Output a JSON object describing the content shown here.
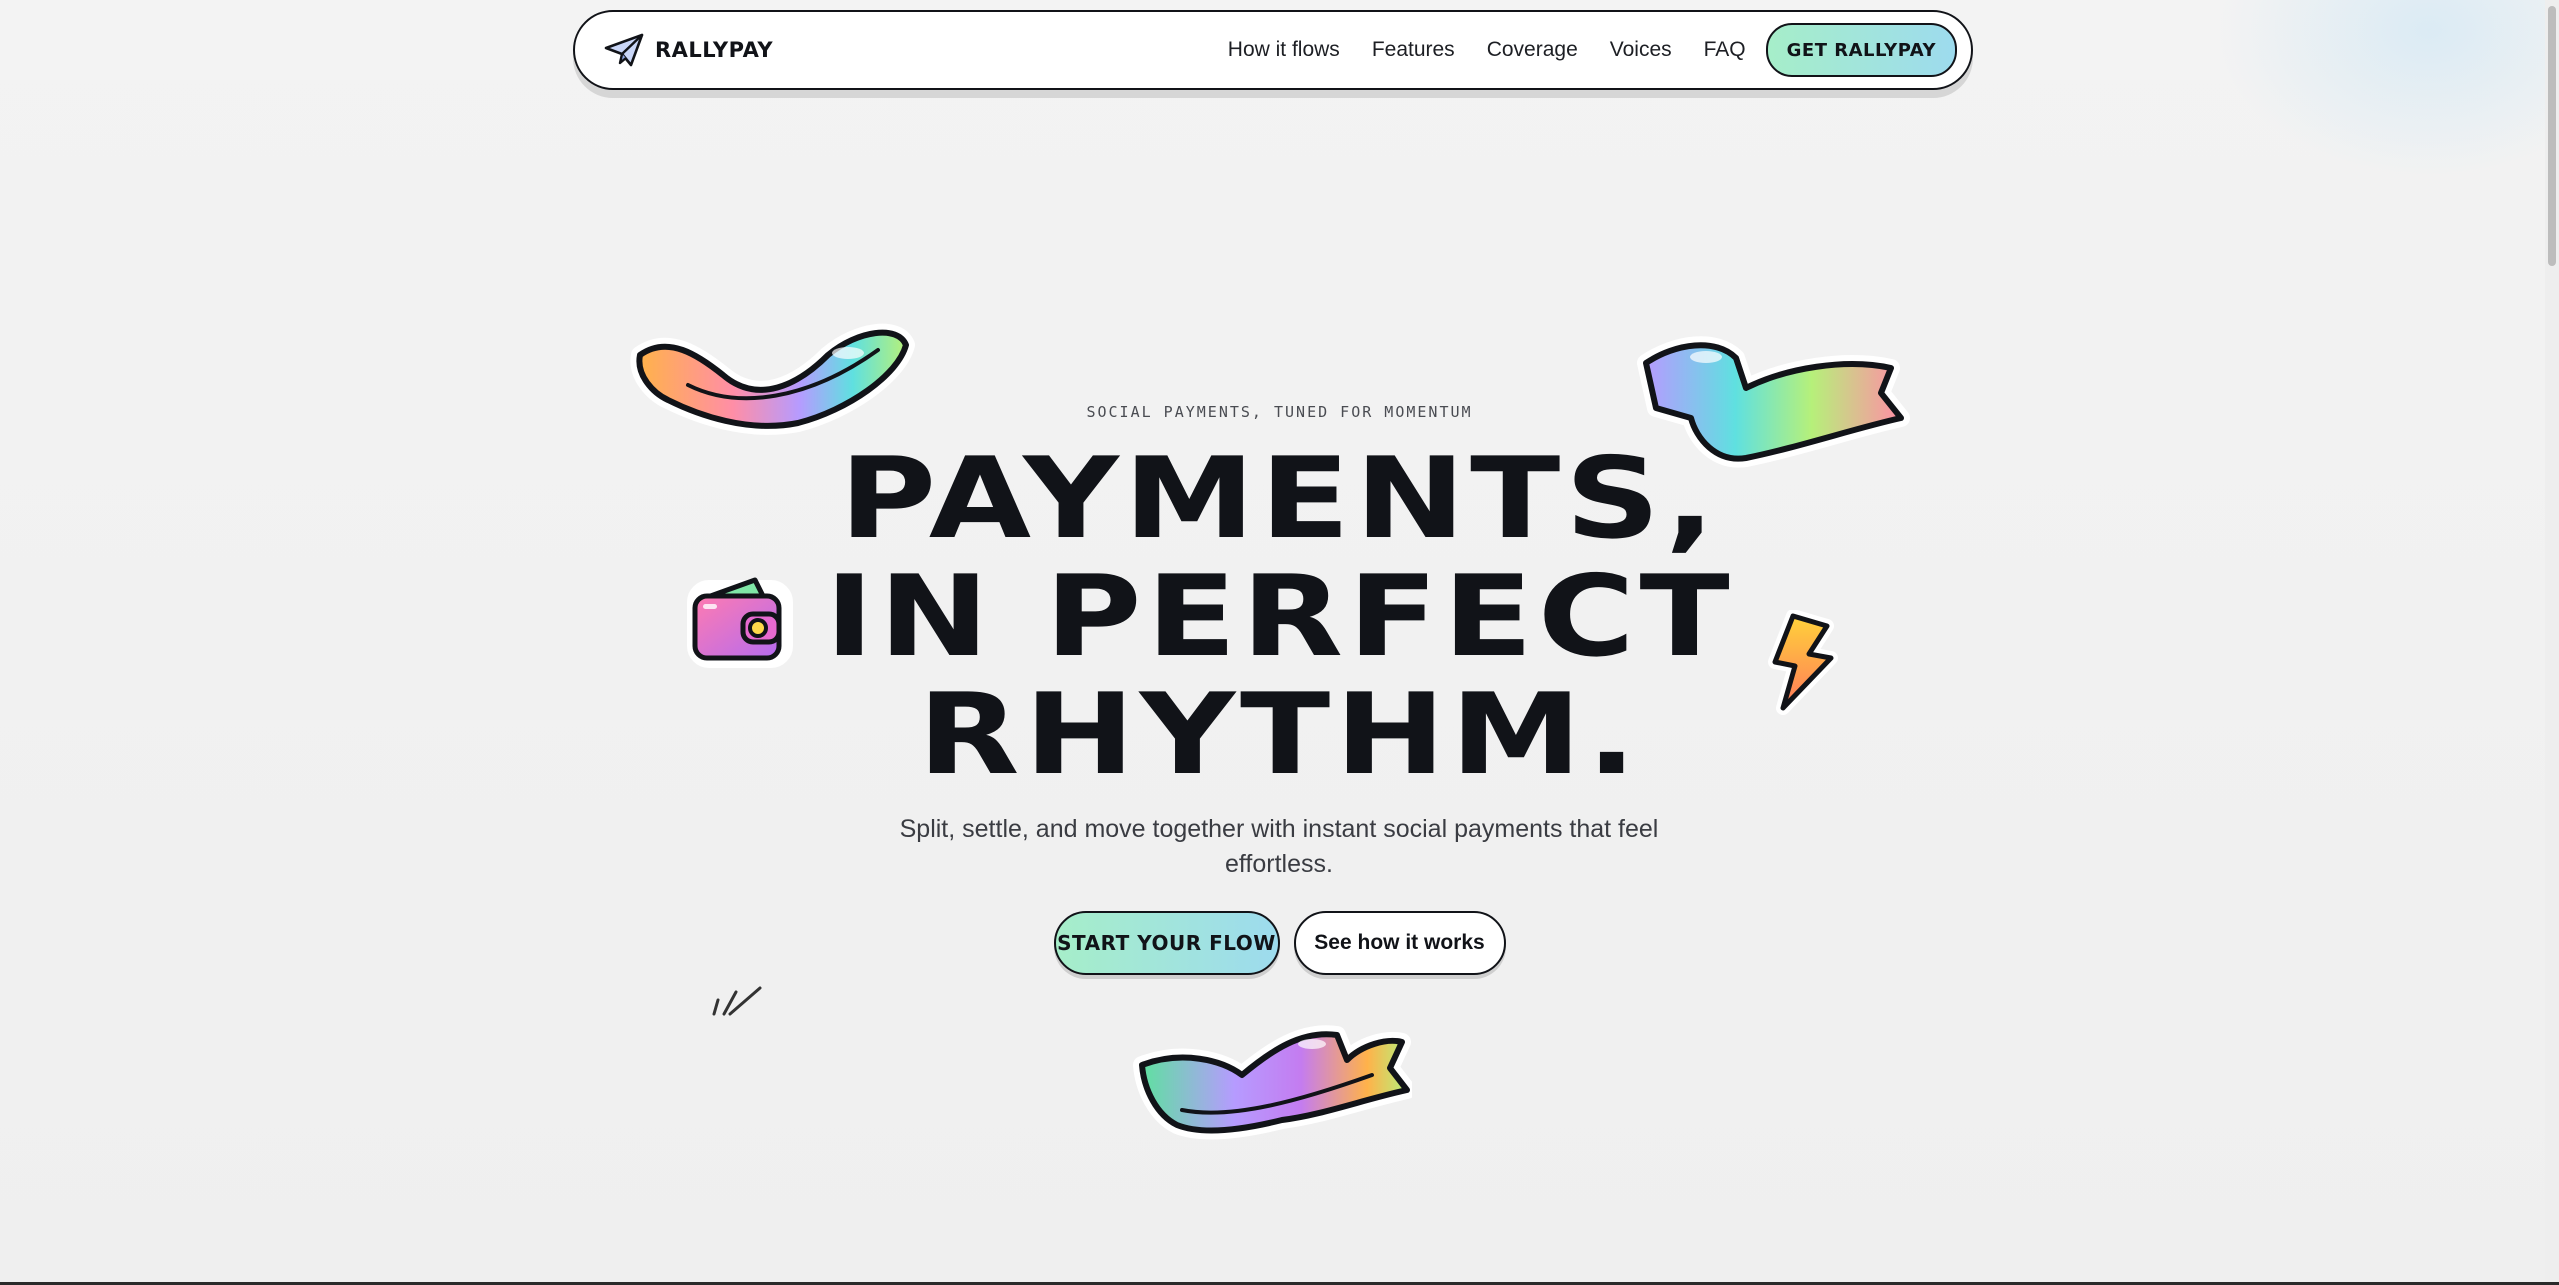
{
  "brand": {
    "name": "RALLYPAY",
    "logo_icon": "paper-plane-icon"
  },
  "nav": {
    "links": [
      "How it flows",
      "Features",
      "Coverage",
      "Voices",
      "FAQ"
    ],
    "cta_label": "GET RALLYPAY"
  },
  "hero": {
    "eyebrow": "SOCIAL PAYMENTS, TUNED FOR MOMENTUM",
    "headline_lines": [
      "PAYMENTS,",
      "IN PERFECT",
      "RHYTHM."
    ],
    "subtitle": "Split, settle, and move together with instant social payments that feel effortless.",
    "primary_cta": "START YOUR FLOW",
    "secondary_cta": "See how it works"
  },
  "decorations": {
    "stickers": [
      "ribbon-sticker",
      "ribbon-sticker",
      "wallet-sticker",
      "lightning-sticker",
      "sparkle-lines-icon",
      "ribbon-sticker"
    ]
  },
  "colors": {
    "ink": "#111318",
    "cta_gradient_start": "#a6eec9",
    "cta_gradient_end": "#9ddbee",
    "background": "#f2f2f2"
  }
}
